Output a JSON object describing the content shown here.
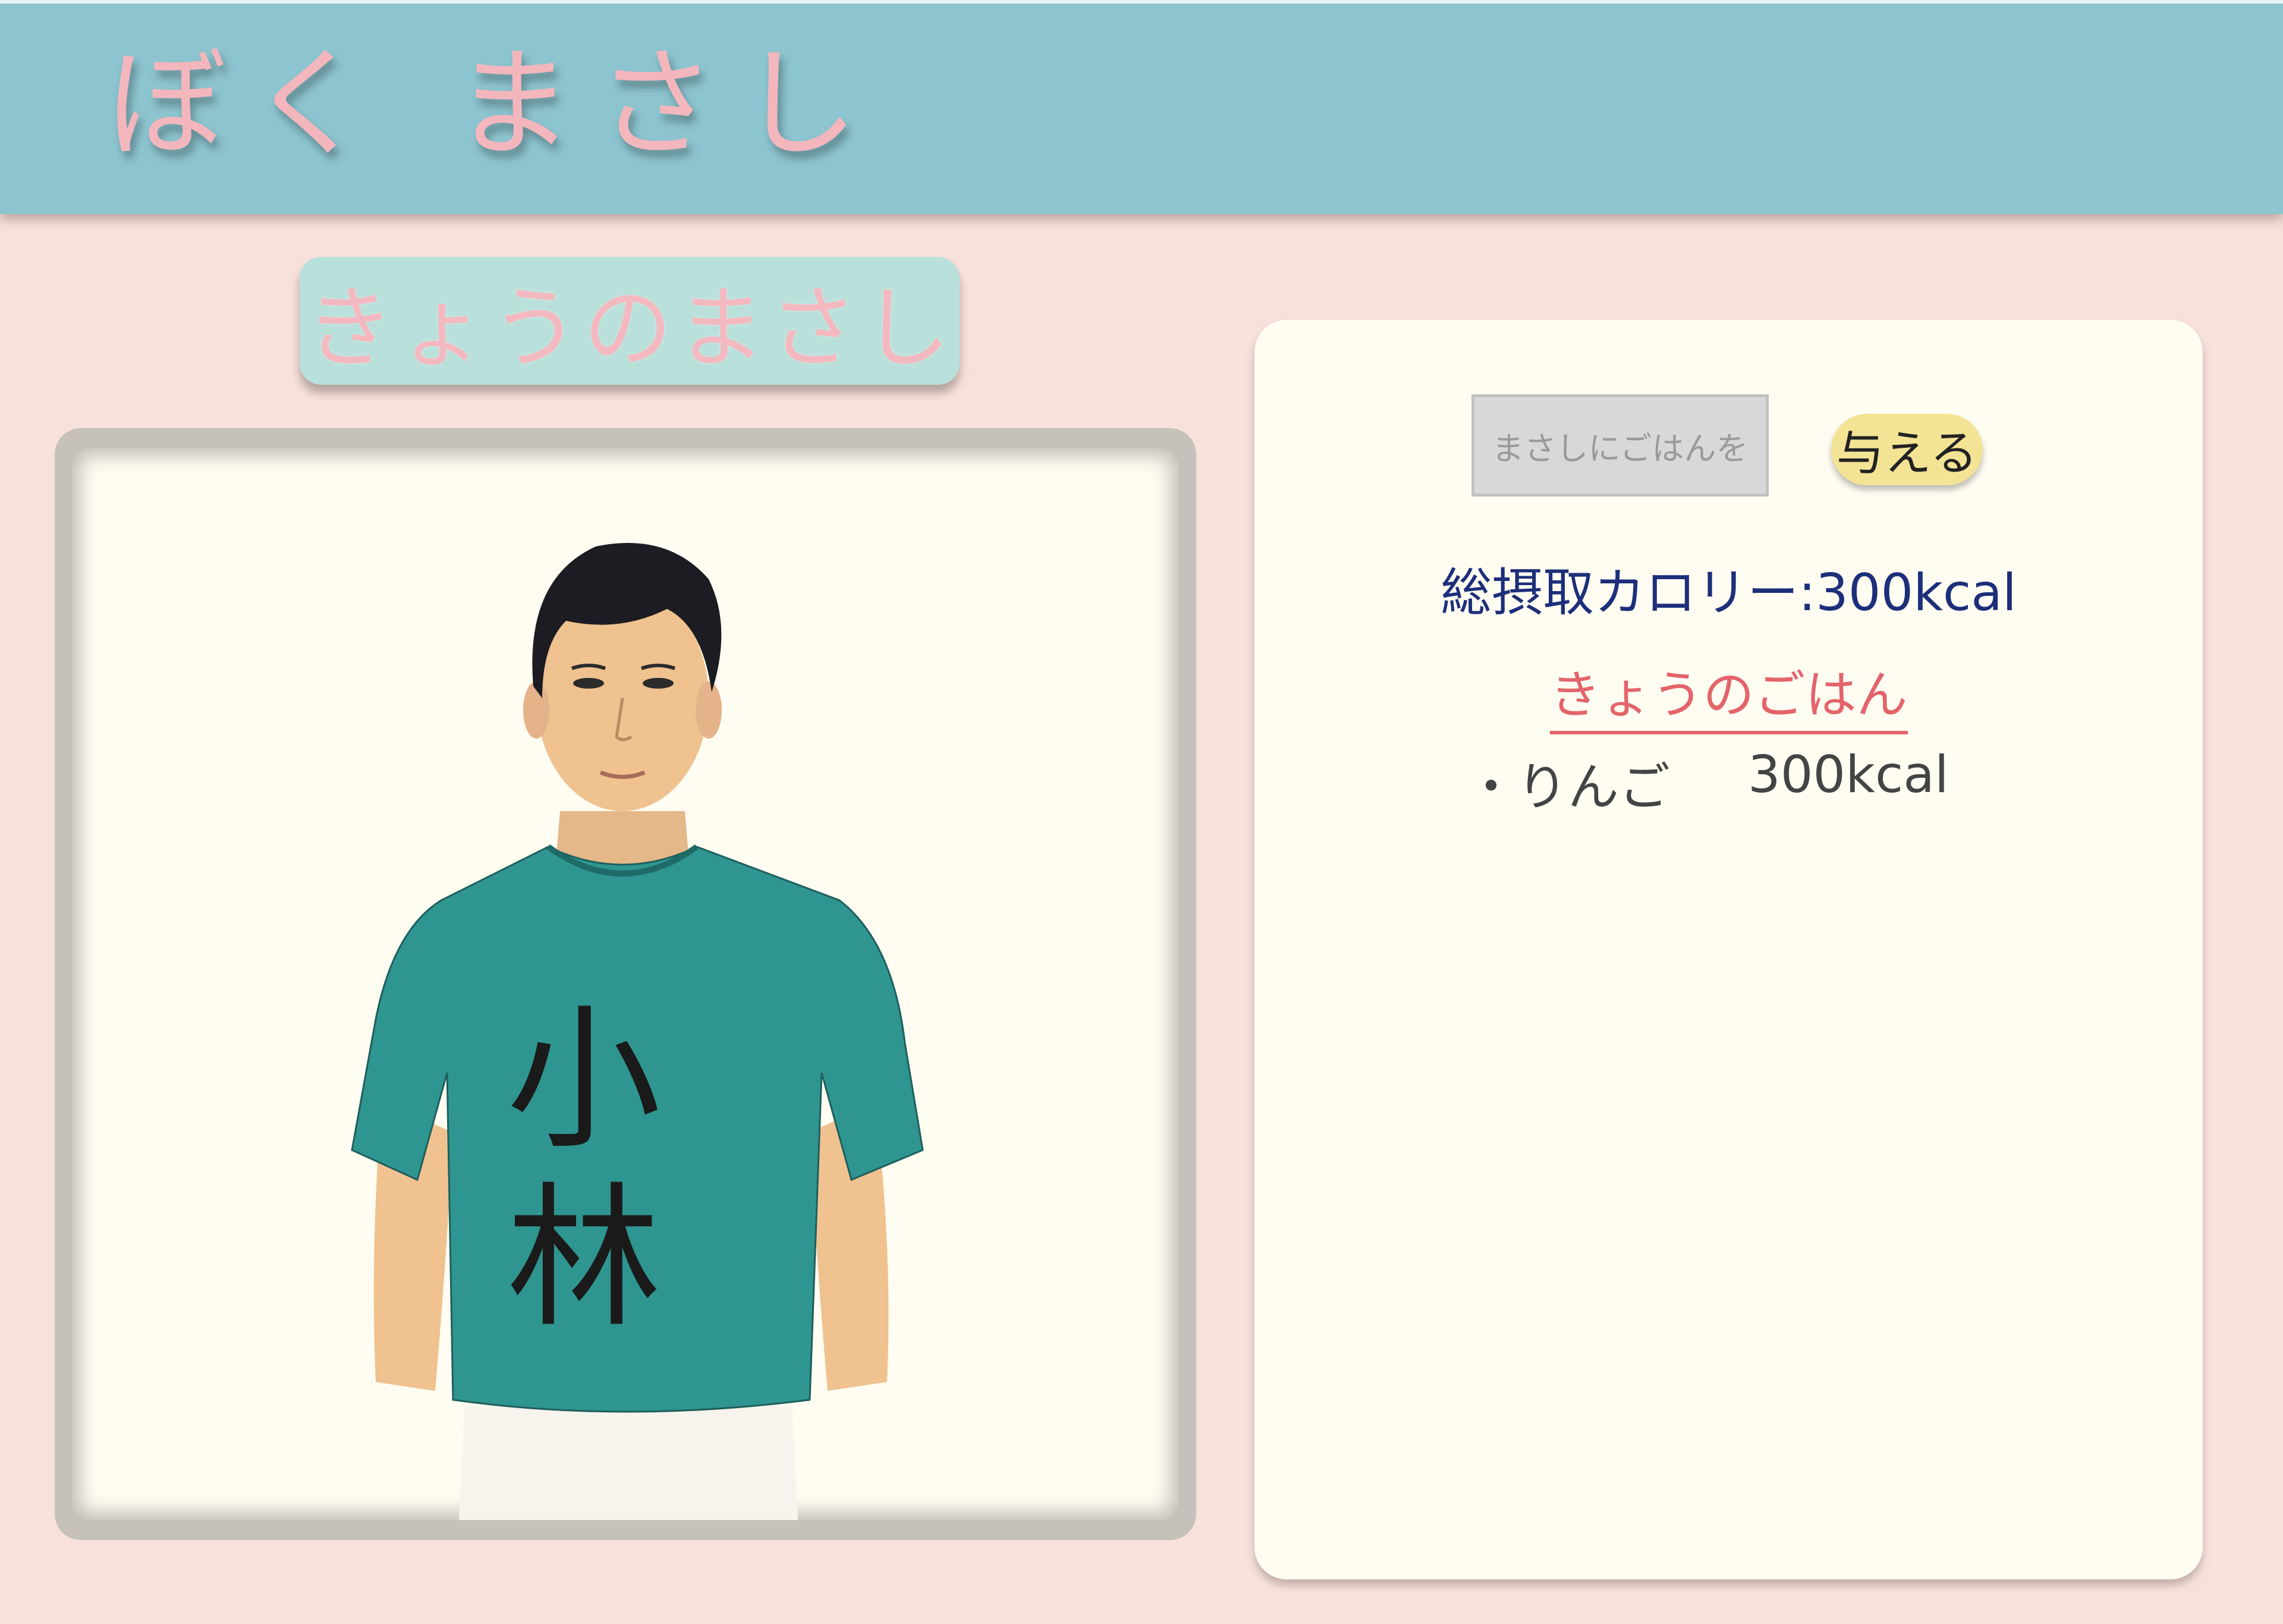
{
  "header": {
    "title": "ぼく まさし"
  },
  "section": {
    "label": "きょうのまさし"
  },
  "portrait": {
    "shirt_text": [
      "小",
      "林"
    ]
  },
  "feed": {
    "input_placeholder": "まさしにごはんを",
    "give_button": "与える"
  },
  "stats": {
    "total_calories": "総摂取カロリー:300kcal"
  },
  "today": {
    "heading": "きょうのごはん",
    "items": [
      {
        "name": "・りんご",
        "kcal": "300kcal"
      }
    ]
  },
  "colors": {
    "header": "#8cc4cf",
    "background": "#f9e1db",
    "title": "#f4b6bd",
    "label_box": "#b9e0da",
    "button": "#f3e394",
    "total_text": "#1d2f7a",
    "heading_text": "#e3646a",
    "shirt": "#2f9590"
  }
}
